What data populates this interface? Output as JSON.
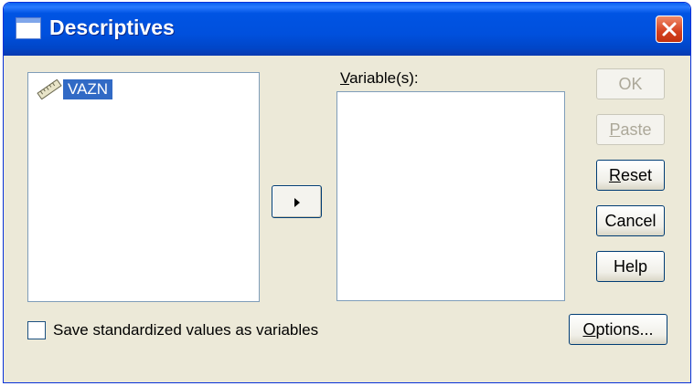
{
  "window": {
    "title": "Descriptives"
  },
  "source_list": {
    "items": [
      {
        "label": "VAZN",
        "icon": "scale-variable-ruler-icon",
        "selected": true
      }
    ]
  },
  "target_list": {
    "label_prefix": "",
    "label_mnemonic": "V",
    "label_rest": "ariable(s):",
    "items": []
  },
  "buttons": {
    "ok": "OK",
    "paste": "Paste",
    "reset": "Reset",
    "cancel": "Cancel",
    "help": "Help",
    "options": "Options..."
  },
  "checkbox": {
    "label": "Save standardized values as variables",
    "checked": false
  },
  "colors": {
    "titlebar": "#0054e3",
    "dialog_bg": "#ece9d8",
    "selection": "#316ac5",
    "close": "#d4401e"
  }
}
